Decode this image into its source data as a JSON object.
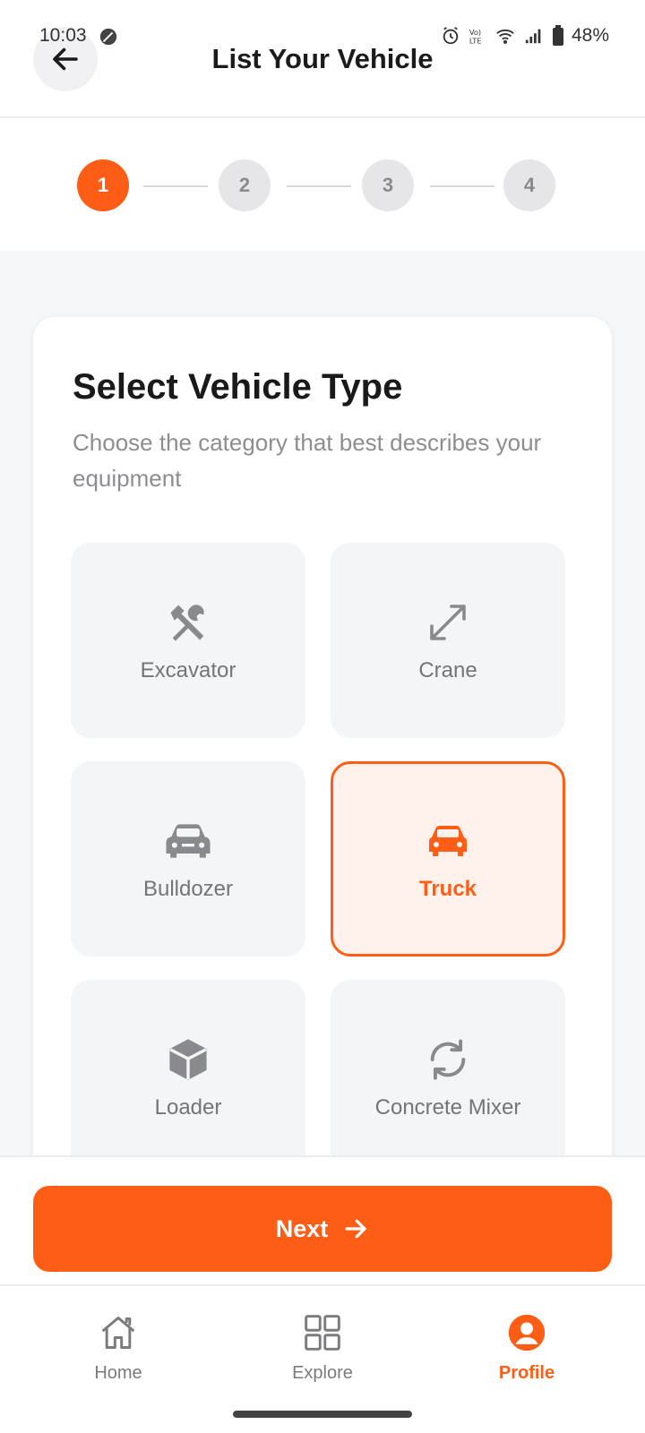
{
  "status_bar": {
    "time": "10:03",
    "battery": "48%"
  },
  "header": {
    "title": "List Your Vehicle",
    "back_icon": "arrow-left-icon"
  },
  "stepper": {
    "steps": [
      "1",
      "2",
      "3",
      "4"
    ],
    "active_step": 1
  },
  "card": {
    "title": "Select Vehicle Type",
    "subtitle": "Choose the category that best describes your equipment"
  },
  "vehicle_types": [
    {
      "label": "Excavator",
      "icon": "tools-icon",
      "selected": false
    },
    {
      "label": "Crane",
      "icon": "expand-arrows-icon",
      "selected": false
    },
    {
      "label": "Bulldozer",
      "icon": "car-icon",
      "selected": false
    },
    {
      "label": "Truck",
      "icon": "car-icon",
      "selected": true
    },
    {
      "label": "Loader",
      "icon": "cube-icon",
      "selected": false
    },
    {
      "label": "Concrete Mixer",
      "icon": "refresh-icon",
      "selected": false
    }
  ],
  "footer": {
    "next_label": "Next"
  },
  "bottom_nav": {
    "items": [
      {
        "label": "Home",
        "icon": "home-icon",
        "active": false
      },
      {
        "label": "Explore",
        "icon": "grid-icon",
        "active": false
      },
      {
        "label": "Profile",
        "icon": "user-circle-icon",
        "active": true
      }
    ]
  },
  "colors": {
    "accent": "#fe5d15",
    "inactive": "#8a8a8e",
    "background": "#f6f7f9"
  }
}
